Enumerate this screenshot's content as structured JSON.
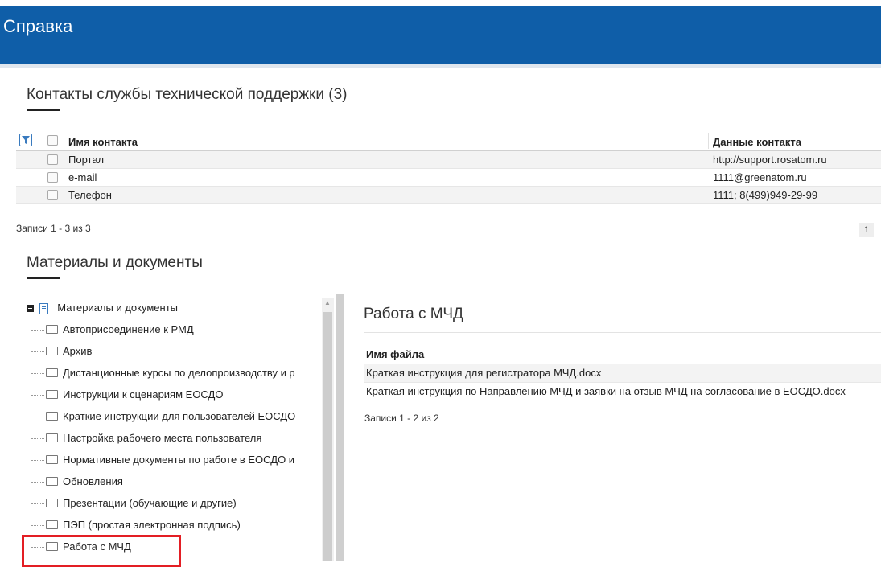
{
  "header": {
    "title": "Справка"
  },
  "contacts": {
    "title": "Контакты службы технической поддержки (3)",
    "columns": {
      "name": "Имя контакта",
      "data": "Данные контакта"
    },
    "rows": [
      {
        "name": "Портал",
        "data": "http://support.rosatom.ru"
      },
      {
        "name": "e-mail",
        "data": "1111@greenatom.ru"
      },
      {
        "name": "Телефон",
        "data": "1111; 8(499)949-29-99"
      }
    ],
    "records": "Записи 1 - 3 из 3",
    "page": "1"
  },
  "materials": {
    "title": "Материалы и документы",
    "tree": {
      "root": "Материалы и документы",
      "items": [
        "Автоприсоединение к РМД",
        "Архив",
        "Дистанционные курсы по делопроизводству и р",
        "Инструкции к сценариям ЕОСДО",
        "Краткие инструкции для пользователей ЕОСДО",
        "Настройка рабочего места пользователя",
        "Нормативные документы по работе в ЕОСДО и",
        "Обновления",
        "Презентации (обучающие и другие)",
        "ПЭП (простая электронная подпись)",
        "Работа с МЧД"
      ]
    },
    "panel": {
      "title": "Работа с МЧД",
      "column": "Имя файла",
      "files": [
        "Краткая инструкция для регистратора МЧД.docx",
        "Краткая инструкция по Направлению МЧД и заявки на отзыв МЧД на согласование в ЕОСДО.docx"
      ],
      "records": "Записи 1 - 2 из 2"
    }
  }
}
